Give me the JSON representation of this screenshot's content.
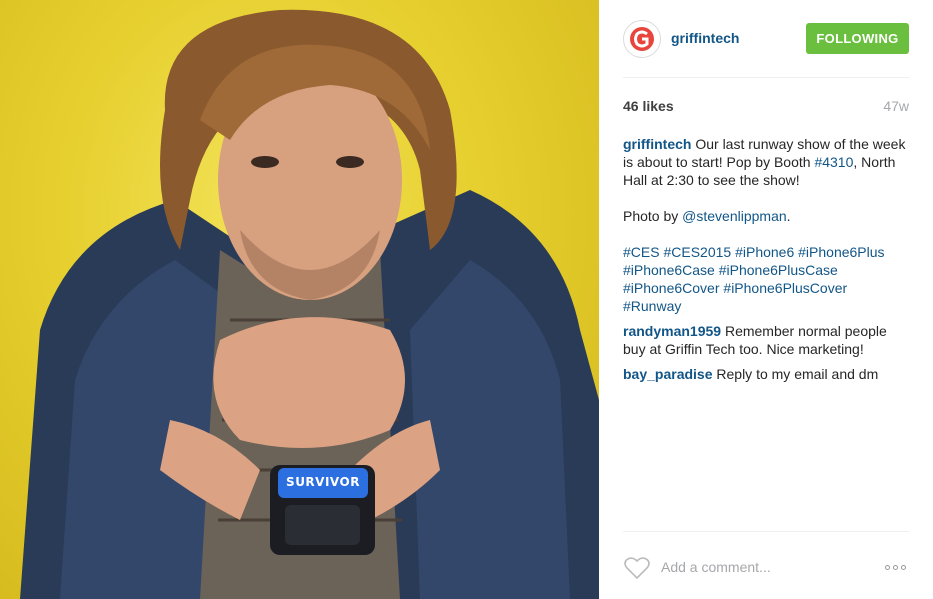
{
  "post": {
    "product_label": "SURVIVOR",
    "colors": {
      "background_yellow": "#e6cf2e",
      "follow_green": "#6bbf3f",
      "link_blue": "#125688",
      "brand_red": "#e8453c"
    }
  },
  "header": {
    "avatar_icon": "griffin-logo-icon",
    "username": "griffintech",
    "follow_label": "FOLLOWING"
  },
  "meta": {
    "likes": "46 likes",
    "age": "47w"
  },
  "caption": {
    "username": "griffintech",
    "text_1": " Our last runway show of the week is about to start! Pop by Booth ",
    "hashtag_booth": "#4310",
    "text_2": ", North Hall at 2:30 to see the show!",
    "photo_by": "Photo by ",
    "photographer": "@stevenlippman",
    "period": ".",
    "hashtags": [
      "#CES",
      "#CES2015",
      "#iPhone6",
      "#iPhone6Plus",
      "#iPhone6Case",
      "#iPhone6PlusCase",
      "#iPhone6Cover",
      "#iPhone6PlusCover",
      "#Runway"
    ]
  },
  "comments": [
    {
      "username": "randyman1959",
      "text": " Remember normal people buy at Griffin Tech too. Nice marketing!"
    },
    {
      "username": "bay_paradise",
      "text": " Reply to my email and dm"
    }
  ],
  "footer": {
    "like_icon": "heart-icon",
    "comment_placeholder": "Add a comment...",
    "more_icon": "more-options-icon"
  }
}
